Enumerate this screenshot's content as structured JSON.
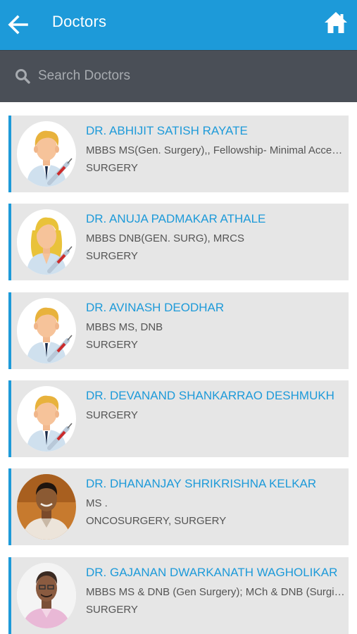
{
  "header": {
    "title": "Doctors",
    "back_icon": "arrow-left-icon",
    "home_icon": "home-icon",
    "bar_color": "#1d9ad9"
  },
  "search": {
    "placeholder": "Search Doctors",
    "value": "",
    "icon": "search-icon",
    "bar_color": "#4a4f57"
  },
  "doctors": [
    {
      "name": "DR. ABHIJIT SATISH RAYATE",
      "line1": "MBBS MS(Gen. Surgery),, Fellowship- Minimal Access Surgery",
      "line2": "SURGERY",
      "avatar": "male-doctor-icon"
    },
    {
      "name": "DR. ANUJA PADMAKAR ATHALE",
      "line1": "MBBS DNB(GEN. SURG), MRCS",
      "line2": "SURGERY",
      "avatar": "female-doctor-icon"
    },
    {
      "name": "DR. AVINASH DEODHAR",
      "line1": "MBBS MS, DNB",
      "line2": "SURGERY",
      "avatar": "male-doctor-icon"
    },
    {
      "name": "DR. DEVANAND SHANKARRAO DESHMUKH",
      "line1": "SURGERY",
      "line2": "",
      "avatar": "male-doctor-icon"
    },
    {
      "name": "DR. DHANANJAY SHRIKRISHNA KELKAR",
      "line1": "MS .",
      "line2": "ONCOSURGERY, SURGERY",
      "avatar": "doctor-photo"
    },
    {
      "name": "DR. GAJANAN DWARKANATH WAGHOLIKAR",
      "line1": "MBBS MS & DNB (Gen Surgery); MCh & DNB (Surgical Oncology)",
      "line2": "SURGERY",
      "avatar": "doctor-photo"
    }
  ],
  "colors": {
    "accent": "#1d9ad9",
    "card_bg": "#e6e6e6",
    "secondary_text": "#555555"
  }
}
